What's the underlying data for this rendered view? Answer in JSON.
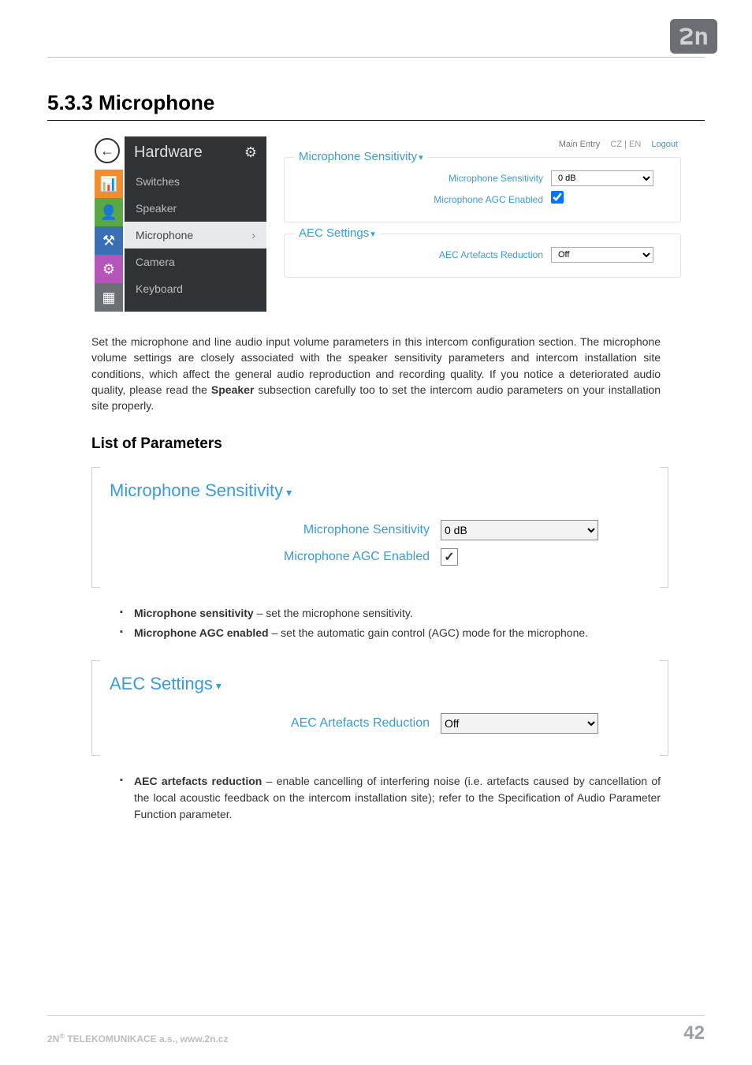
{
  "brand": {
    "name": "2N"
  },
  "section": {
    "number": "5.3.3",
    "title": "Microphone",
    "full": "5.3.3 Microphone"
  },
  "screenshot": {
    "top_links": {
      "address": "Main Entry",
      "lang": "CZ | EN",
      "logout": "Logout"
    },
    "sidebar": {
      "header": "Hardware",
      "items": [
        {
          "label": "Switches",
          "active": false
        },
        {
          "label": "Speaker",
          "active": false
        },
        {
          "label": "Microphone",
          "active": true
        },
        {
          "label": "Camera",
          "active": false
        },
        {
          "label": "Keyboard",
          "active": false
        }
      ]
    },
    "groups": {
      "sensitivity": {
        "legend": "Microphone Sensitivity",
        "rows": {
          "sensitivity_label": "Microphone Sensitivity",
          "sensitivity_value": "0 dB",
          "agc_label": "Microphone AGC Enabled",
          "agc_checked": true
        }
      },
      "aec": {
        "legend": "AEC Settings",
        "rows": {
          "artefacts_label": "AEC Artefacts Reduction",
          "artefacts_value": "Off"
        }
      }
    }
  },
  "paragraph": {
    "pre": "Set the microphone and line audio input volume parameters in this intercom configuration section. The microphone volume settings are closely associated with the speaker sensitivity parameters and intercom installation site conditions, which affect the general audio reproduction and recording quality. If you notice a deteriorated audio quality, please read the ",
    "strong": "Speaker",
    "post": " subsection carefully too to set the intercom audio parameters on your installation site properly."
  },
  "list_heading": "List of Parameters",
  "panel_sensitivity": {
    "legend": "Microphone Sensitivity",
    "row1_label": "Microphone Sensitivity",
    "row1_value": "0 dB",
    "row2_label": "Microphone AGC Enabled",
    "row2_checked": true
  },
  "bullets1": [
    {
      "strong": "Microphone sensitivity",
      "rest": " – set the microphone sensitivity."
    },
    {
      "strong": "Microphone AGC enabled",
      "rest": " – set the automatic gain control (AGC) mode for the microphone."
    }
  ],
  "panel_aec": {
    "legend": "AEC Settings",
    "row1_label": "AEC Artefacts Reduction",
    "row1_value": "Off"
  },
  "bullets2": [
    {
      "strong": "AEC artefacts reduction",
      "rest": " – enable cancelling of interfering noise (i.e. artefacts caused by cancellation of the local acoustic feedback on the intercom installation site); refer to the Specification of Audio Parameter Function parameter."
    }
  ],
  "footer": {
    "company": "2N® TELEKOMUNIKACE a.s., www.2n.cz",
    "page": "42"
  }
}
